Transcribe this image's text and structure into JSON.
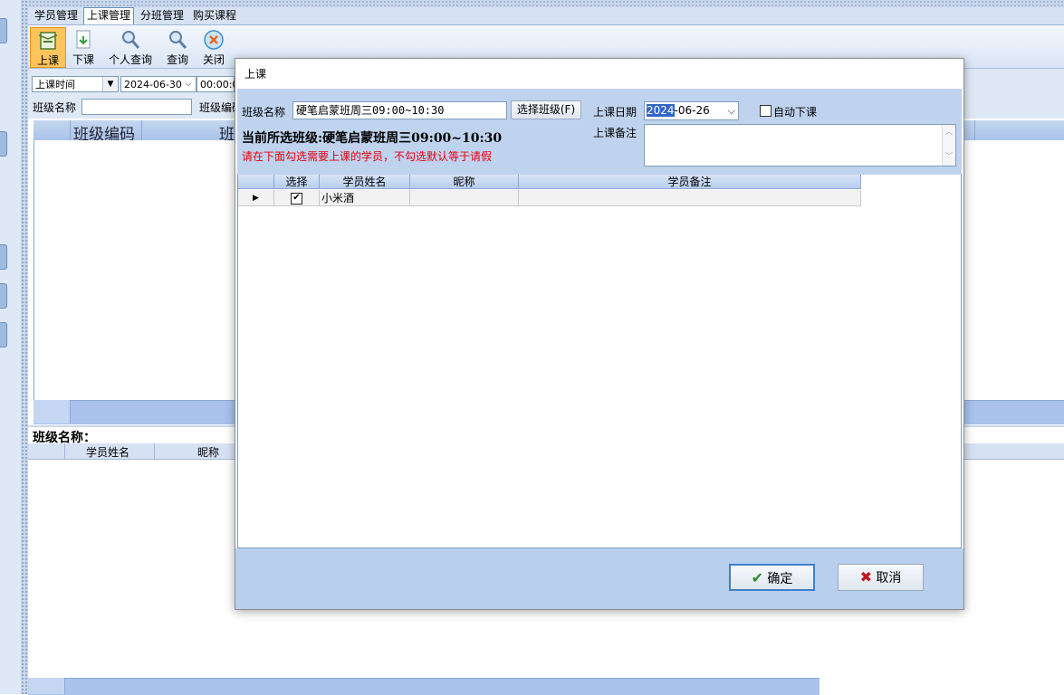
{
  "menu": [
    "学员管理",
    "上课管理",
    "分班管理",
    "购买课程"
  ],
  "toolbar": [
    {
      "label": "上课",
      "icon": "book-icon"
    },
    {
      "label": "下课",
      "icon": "document-arrow-icon"
    },
    {
      "label": "个人查询",
      "icon": "magnifier-icon"
    },
    {
      "label": "查询",
      "icon": "magnifier-icon"
    },
    {
      "label": "关闭",
      "icon": "close-circle-icon"
    }
  ],
  "filter": {
    "time_type": "上课时间",
    "date": "2024-06-30",
    "time": "00:00:0",
    "class_name_label": "班级名称",
    "class_code_label": "班级编码"
  },
  "grid1": {
    "headers": [
      "班级编码",
      "班"
    ]
  },
  "section2": {
    "title": "班级名称：",
    "headers": [
      "学员姓名",
      "昵称"
    ]
  },
  "dialog": {
    "title": "上课",
    "class_name_label": "班级名称",
    "class_name_value": "硬笔启蒙班周三09:00~10:30",
    "select_class_button": "选择班级(F)",
    "date_label": "上课日期",
    "date_year": "2024",
    "date_rest": "-06-26",
    "auto_dismiss_label": "自动下课",
    "note_label": "上课备注",
    "current_class_text": "当前所选班级:硬笔启蒙班周三09:00~10:30",
    "hint": "请在下面勾选需要上课的学员，不勾选默认等于请假",
    "grid_headers": [
      "选择",
      "学员姓名",
      "昵称",
      "学员备注"
    ],
    "rows": [
      {
        "selected": true,
        "name": "小米酒",
        "nickname": "",
        "note": ""
      }
    ],
    "ok": "确定",
    "cancel": "取消"
  },
  "colors": {
    "accent": "#3f7fc7",
    "hint_red": "#e8000b",
    "panel": "#bfd3ee"
  }
}
